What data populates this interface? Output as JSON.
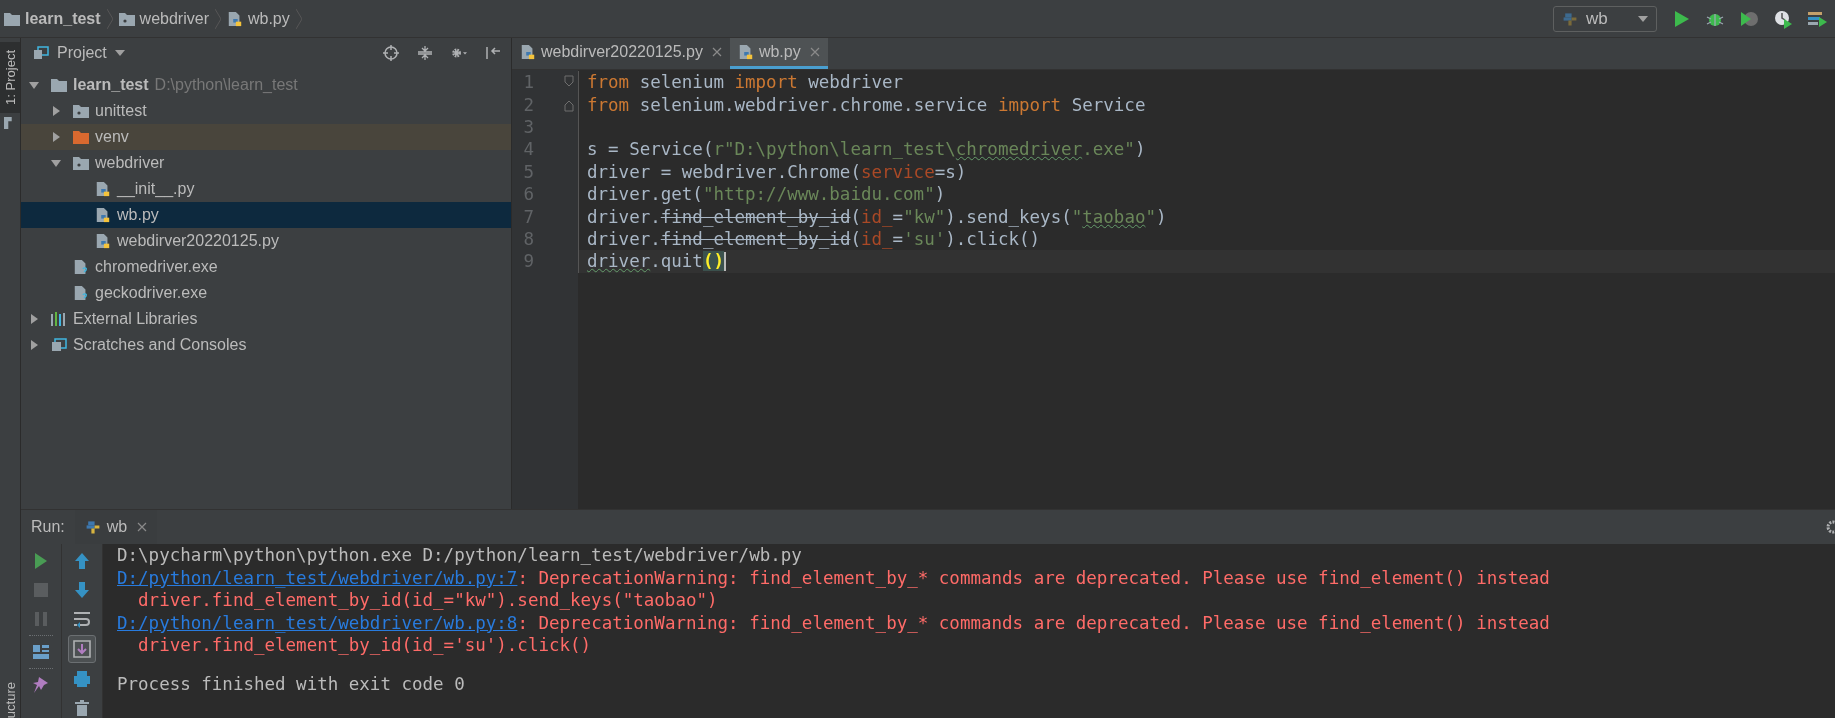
{
  "breadcrumbs": [
    {
      "label": "learn_test",
      "kind": "root"
    },
    {
      "label": "webdriver",
      "kind": "package"
    },
    {
      "label": "wb.py",
      "kind": "python"
    }
  ],
  "run_config": {
    "name": "wb"
  },
  "side_strip": {
    "top_label": "1: Project",
    "bottom_label": "ucture"
  },
  "project_panel": {
    "title": "Project",
    "tree": [
      {
        "name": "learn_test",
        "path": "D:\\python\\learn_test",
        "kind": "root",
        "expanded": true,
        "selected": false,
        "children": [
          {
            "name": "unittest",
            "kind": "package",
            "expanded": false,
            "selected": false
          },
          {
            "name": "venv",
            "kind": "excluded",
            "expanded": false,
            "selected": false
          },
          {
            "name": "webdriver",
            "kind": "package",
            "expanded": true,
            "selected": false,
            "children": [
              {
                "name": "__init__.py",
                "kind": "python",
                "selected": false
              },
              {
                "name": "wb.py",
                "kind": "python",
                "selected": true
              },
              {
                "name": "webdirver20220125.py",
                "kind": "python",
                "selected": false
              }
            ]
          },
          {
            "name": "chromedriver.exe",
            "kind": "unknown",
            "selected": false
          },
          {
            "name": "geckodriver.exe",
            "kind": "unknown",
            "selected": false
          }
        ]
      },
      {
        "name": "External Libraries",
        "kind": "libraries",
        "expanded": false,
        "selected": false
      },
      {
        "name": "Scratches and Consoles",
        "kind": "scratches",
        "expanded": false,
        "selected": false
      }
    ]
  },
  "editor": {
    "tabs": [
      {
        "label": "webdirver20220125.py",
        "selected": false
      },
      {
        "label": "wb.py",
        "selected": true
      }
    ],
    "lines": [
      {
        "number": "1",
        "fold_start": true,
        "current": false,
        "tokens": [
          {
            "text": "from",
            "kind": "kw"
          },
          {
            "text": " selenium ",
            "kind": "plain"
          },
          {
            "text": "import",
            "kind": "kw"
          },
          {
            "text": " webdriver",
            "kind": "plain"
          }
        ]
      },
      {
        "number": "2",
        "fold_end": true,
        "current": false,
        "tokens": [
          {
            "text": "from",
            "kind": "kw"
          },
          {
            "text": " selenium.webdriver.chrome.service ",
            "kind": "plain"
          },
          {
            "text": "import",
            "kind": "kw"
          },
          {
            "text": " Service",
            "kind": "plain"
          }
        ]
      },
      {
        "number": "3",
        "current": false
      },
      {
        "number": "4",
        "current": false,
        "tokens": [
          {
            "text": "s = Service(",
            "kind": "plain"
          },
          {
            "text": "r\"D:\\python\\learn_test\\",
            "kind": "str"
          },
          {
            "text": "chromedriver",
            "kind": "str-typo"
          },
          {
            "text": ".exe\"",
            "kind": "str"
          },
          {
            "text": ")",
            "kind": "plain"
          }
        ]
      },
      {
        "number": "5",
        "current": false,
        "tokens": [
          {
            "text": "driver = webdriver.Chrome(",
            "kind": "plain"
          },
          {
            "text": "service",
            "kind": "param"
          },
          {
            "text": "=s)",
            "kind": "plain"
          }
        ]
      },
      {
        "number": "6",
        "current": false,
        "tokens": [
          {
            "text": "driver.get(",
            "kind": "plain"
          },
          {
            "text": "\"http://www.baidu.com\"",
            "kind": "str"
          },
          {
            "text": ")",
            "kind": "plain"
          }
        ]
      },
      {
        "number": "7",
        "current": false,
        "tokens": [
          {
            "text": "driver.",
            "kind": "plain"
          },
          {
            "text": "find_element_by_id",
            "kind": "deprecated"
          },
          {
            "text": "(",
            "kind": "plain"
          },
          {
            "text": "id_",
            "kind": "param"
          },
          {
            "text": "=",
            "kind": "plain"
          },
          {
            "text": "\"kw\"",
            "kind": "str"
          },
          {
            "text": ").send_keys(",
            "kind": "plain"
          },
          {
            "text": "\"",
            "kind": "str"
          },
          {
            "text": "taobao",
            "kind": "str-typo"
          },
          {
            "text": "\"",
            "kind": "str"
          },
          {
            "text": ")",
            "kind": "plain"
          }
        ]
      },
      {
        "number": "8",
        "current": false,
        "tokens": [
          {
            "text": "driver.",
            "kind": "plain"
          },
          {
            "text": "find_element_by_id",
            "kind": "deprecated"
          },
          {
            "text": "(",
            "kind": "plain"
          },
          {
            "text": "id_",
            "kind": "param"
          },
          {
            "text": "=",
            "kind": "plain"
          },
          {
            "text": "'su'",
            "kind": "str"
          },
          {
            "text": ").click()",
            "kind": "plain"
          }
        ]
      },
      {
        "number": "9",
        "current": true,
        "tokens": [
          {
            "text": "driver",
            "kind": "typo"
          },
          {
            "text": ".quit",
            "kind": "plain"
          },
          {
            "text": "()",
            "kind": "brace"
          }
        ]
      }
    ]
  },
  "run_panel": {
    "label": "Run:",
    "tabs": [
      {
        "label": "wb"
      }
    ],
    "toolbar_left": [
      {
        "kind": "rerun",
        "disabled": false
      },
      {
        "kind": "stop",
        "disabled": true
      },
      {
        "kind": "pause",
        "disabled": true
      },
      {
        "kind": "layout"
      },
      {
        "kind": "pin"
      }
    ],
    "toolbar_right": [
      {
        "kind": "up",
        "on": false
      },
      {
        "kind": "down",
        "on": false
      },
      {
        "kind": "wrap",
        "on": false
      },
      {
        "kind": "scroll-end",
        "on": true
      },
      {
        "kind": "print",
        "on": false
      },
      {
        "kind": "trash",
        "on": false
      }
    ],
    "console": [
      {
        "segments": [
          {
            "text": "D:\\pycharm\\python\\python.exe D:/python/learn_test/webdriver/wb.py",
            "kind": "plain"
          }
        ]
      },
      {
        "segments": [
          {
            "text": "D:/python/learn_test/webdriver/wb.py:7",
            "kind": "link"
          },
          {
            "text": ": DeprecationWarning: find_element_by_* commands are deprecated. Please use find_element() instead",
            "kind": "error"
          }
        ]
      },
      {
        "segments": [
          {
            "text": "  driver.find_element_by_id(id_=\"kw\").send_keys(\"taobao\")",
            "kind": "error"
          }
        ]
      },
      {
        "segments": [
          {
            "text": "D:/python/learn_test/webdriver/wb.py:8",
            "kind": "link"
          },
          {
            "text": ": DeprecationWarning: find_element_by_* commands are deprecated. Please use find_element() instead",
            "kind": "error"
          }
        ]
      },
      {
        "segments": [
          {
            "text": "  driver.find_element_by_id(id_='su').click()",
            "kind": "error"
          }
        ]
      },
      {
        "gap_before": true,
        "segments": [
          {
            "text": "Process finished with exit code 0",
            "kind": "plain"
          }
        ]
      }
    ]
  }
}
